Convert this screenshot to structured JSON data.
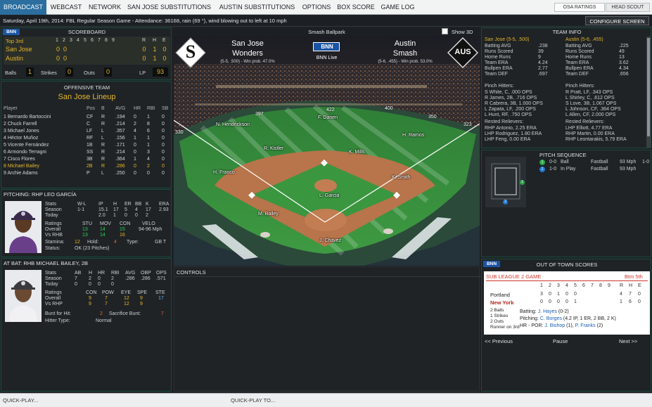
{
  "nav": {
    "tabs": [
      "BROADCAST",
      "WEBCAST",
      "NETWORK",
      "SAN JOSE SUBSTITUTIONS",
      "AUSTIN SUBSTITUTIONS",
      "OPTIONS",
      "BOX SCORE",
      "GAME LOG"
    ],
    "osa_ratings": "OSA RATINGS",
    "head_scout": "HEAD SCOUT",
    "configure": "CONFIGURE SCREEN"
  },
  "status_text": "Saturday, April 19th, 2014: FBL Regular Season Game - Attendance: 36168, rain (69 °), wind blowing out to left at 10 mph",
  "scoreboard": {
    "logo": "BNN",
    "title": "SCOREBOARD",
    "inning_label": "Top 3rd",
    "innings": [
      "1",
      "2",
      "3",
      "4",
      "5",
      "6",
      "7",
      "8",
      "9"
    ],
    "rhe_head": [
      "R",
      "H",
      "E"
    ],
    "teams": [
      {
        "name": "San Jose",
        "innings": [
          "0",
          "0",
          "",
          "",
          "",
          "",
          "",
          "",
          ""
        ],
        "r": "0",
        "h": "1",
        "e": "0"
      },
      {
        "name": "Austin",
        "innings": [
          "0",
          "0",
          "",
          "",
          "",
          "",
          "",
          "",
          ""
        ],
        "r": "0",
        "h": "1",
        "e": "0"
      }
    ],
    "balls_label": "Balls",
    "balls": "1",
    "strikes_label": "Strikes",
    "strikes": "0",
    "outs_label": "Outs",
    "outs": "0",
    "lp_label": "LP",
    "lp": "93"
  },
  "offense": {
    "title": "OFFENSIVE TEAM",
    "lineup_title": "San Jose Lineup",
    "headers": [
      "Player",
      "Pos",
      "B",
      "AVG",
      "HR",
      "RBI",
      "SB"
    ],
    "rows": [
      [
        "1 Bernardo Bartoccini",
        "CF",
        "R",
        ".194",
        "0",
        "1",
        "0"
      ],
      [
        "2 Chuck Farrell",
        "C",
        "R",
        ".214",
        "2",
        "8",
        "0"
      ],
      [
        "3 Michael Jones",
        "LF",
        "L",
        ".357",
        "4",
        "6",
        "0"
      ],
      [
        "4 Héctor Muñoz",
        "RF",
        "L",
        ".156",
        "1",
        "1",
        "0"
      ],
      [
        "5 Vicente Fernández",
        "1B",
        "R",
        ".171",
        "0",
        "1",
        "0"
      ],
      [
        "6 Armondo Terragni",
        "SS",
        "R",
        ".214",
        "0",
        "3",
        "0"
      ],
      [
        "7 Cisco Flores",
        "3B",
        "R",
        ".364",
        "1",
        "4",
        "0"
      ],
      [
        "8 Michael Bailey",
        "2B",
        "R",
        ".286",
        "0",
        "2",
        "0"
      ],
      [
        "9 Archie Adams",
        "P",
        "L",
        ".250",
        "0",
        "0",
        "0"
      ]
    ]
  },
  "pitching": {
    "title": "PITCHING: RHP LEO GARCÍA",
    "stats_label": "Stats",
    "stat_heads": [
      "W-L",
      "IP",
      "H",
      "ER",
      "BB",
      "K",
      "ERA"
    ],
    "season_label": "Season",
    "season": [
      "1-1",
      "15.1",
      "17",
      "5",
      "4",
      "17",
      "2.93"
    ],
    "today_label": "Today",
    "today": [
      "",
      "2.0",
      "1",
      "0",
      "0",
      "2",
      ""
    ],
    "ratings_label": "Ratings",
    "rating_heads": [
      "STU",
      "MOV",
      "CON",
      "VELO"
    ],
    "overall_label": "Overall",
    "overall": [
      "13",
      "14",
      "15",
      "94-96 Mph"
    ],
    "vs_label": "Vs RHB",
    "vs": [
      "13",
      "14",
      "16"
    ],
    "stamina_label": "Stamina:",
    "stamina": "12",
    "hold_label": "Hold:",
    "hold": "4",
    "type_label": "Type:",
    "type": "GB T",
    "status_label": "Status:",
    "status": "OK (23 Pitches)"
  },
  "atbat": {
    "title": "AT BAT: RHB MICHAEL BAILEY, 2B",
    "stats_label": "Stats",
    "stat_heads": [
      "AB",
      "H",
      "HR",
      "RBI",
      "AVG",
      "OBP",
      "OPS"
    ],
    "season_label": "Season",
    "season": [
      "7",
      "2",
      "0",
      "2",
      ".286",
      ".286",
      ".571"
    ],
    "today_label": "Today",
    "today": [
      "0",
      "0",
      "0",
      "0",
      "",
      "",
      ""
    ],
    "ratings_label": "Ratings",
    "rating_heads": [
      "CON",
      "POW",
      "EYE",
      "SPE",
      "STE"
    ],
    "overall_label": "Overall",
    "overall": [
      "9",
      "7",
      "12",
      "9",
      "17"
    ],
    "vs_label": "Vs RHP",
    "vs": [
      "9",
      "7",
      "12",
      "9"
    ],
    "bunt_label": "Bunt for Hit:",
    "bunt": "2",
    "sac_label": "Sacrifice Bunt:",
    "sac": "7",
    "hitter_label": "Hitter Type:",
    "hitter": "Normal"
  },
  "field": {
    "title": "Smash Ballpark",
    "show3d": "Show 3D",
    "home_logo": "S",
    "home_name1": "San Jose",
    "home_name2": "Wonders",
    "home_record": "(5-5, .500) - Win prob. 47.0%",
    "away_logo": "AUS",
    "away_name1": "Austin",
    "away_name2": "Smash",
    "away_record": "(5-6, .455) - Win prob. 53.0%",
    "bnn_live": "BNN Live",
    "bnn": "BNN",
    "walls": [
      "330",
      "397",
      "422",
      "400",
      "350",
      "323"
    ],
    "players": [
      "N. Hendrickson",
      "F. Danen",
      "H. Ramos",
      "R. Kistler",
      "K. Mills",
      "H. Franco",
      "K. Smith",
      "L. Garcia",
      "M. Bailey",
      "J. Chavez"
    ]
  },
  "controls": {
    "title": "CONTROLS"
  },
  "team_info": {
    "title": "TEAM INFO",
    "home_head": "San Jose (5-5, .500)",
    "away_head": "Austin (5-6, .455)",
    "stats": [
      [
        "Batting AVG",
        ".238",
        "Batting AVG",
        ".225"
      ],
      [
        "Runs Scored",
        "39",
        "Runs Scored",
        "49"
      ],
      [
        "Home Runs",
        "9",
        "Home Runs",
        "13"
      ],
      [
        "Team ERA",
        "4.24",
        "Team ERA",
        "3.62"
      ],
      [
        "Bullpen ERA",
        "2.77",
        "Bullpen ERA",
        "4.34"
      ],
      [
        "Team DEF",
        ".697",
        "Team DEF",
        ".656"
      ]
    ],
    "pinch_label": "Pinch Hitters:",
    "home_pinch": [
      "S White, C, .000 OPS",
      "R James, 2B, .716 OPS",
      "R Cabrera, 3B, 1.000 OPS",
      "L Zapata, LF, .200 OPS",
      "L Hunt, RF, .750 OPS"
    ],
    "away_pinch": [
      "R Pratt, LF, .343 OPS",
      "L Shirley, C, .612 OPS",
      "S Love, 3B, 1.067 OPS",
      "L Johnson, CF, .364 OPS",
      "L Allen, CF, 2.000 OPS"
    ],
    "relief_label": "Rested Relievers:",
    "home_relief": [
      "RHP Antonio, 2.25 ERA",
      "LHP Rodriguez, 1.80 ERA",
      "LHP Feng, 0.00 ERA"
    ],
    "away_relief": [
      "LHP Elliott, 4.77 ERA",
      "RHP Martin, 0.00 ERA",
      "RHP Leontarakis, 5.79 ERA"
    ]
  },
  "pitch_seq": {
    "title": "PITCH SEQUENCE",
    "rows": [
      {
        "num": "1",
        "count": "0-0",
        "result": "Ball",
        "pitch": "Fastball",
        "speed": "93 Mph",
        "after": "1-0"
      },
      {
        "num": "2",
        "count": "1-0",
        "result": "In Play",
        "pitch": "Fastball",
        "speed": "93 Mph",
        "after": ""
      }
    ]
  },
  "oot": {
    "title": "OUT OF TOWN SCORES",
    "bnn": "BNN",
    "league": "SUB LEAGUE 2 GAME",
    "inning": "Btm 5th",
    "innings": [
      "1",
      "2",
      "3",
      "4",
      "5",
      "6",
      "7",
      "8",
      "9"
    ],
    "rhe": [
      "R",
      "H",
      "E"
    ],
    "teams": [
      {
        "name": "Portland",
        "innings": [
          "3",
          "0",
          "1",
          "0",
          "0",
          "",
          "",
          "",
          ""
        ],
        "r": "4",
        "h": "7",
        "e": "0"
      },
      {
        "name": "New York",
        "innings": [
          "0",
          "0",
          "0",
          "0",
          "1",
          "",
          "",
          "",
          ""
        ],
        "r": "1",
        "h": "6",
        "e": "0"
      }
    ],
    "balls": "2 Balls",
    "strikes": "1 Strikes",
    "outs": "2 Outs",
    "runner": "Runner on 3rd",
    "batting_label": "Batting:",
    "batting_name": "J. Hayes",
    "batting_line": "(0-2)",
    "pitching_label": "Pitching:",
    "pitching_name": "C. Borges",
    "pitching_line": "(4.2 IP, 1 ER, 2 BB, 2 K)",
    "hr_label": "HR - POR:",
    "hr_1": "J. Bishop",
    "hr_1n": "(1),",
    "hr_2": "P. Franks",
    "hr_2n": "(2)",
    "prev": "<< Previous",
    "pause": "Pause",
    "next": "Next >>"
  },
  "bottom": {
    "qp": "QUICK-PLAY...",
    "qpt": "QUICK-PLAY TO..."
  }
}
